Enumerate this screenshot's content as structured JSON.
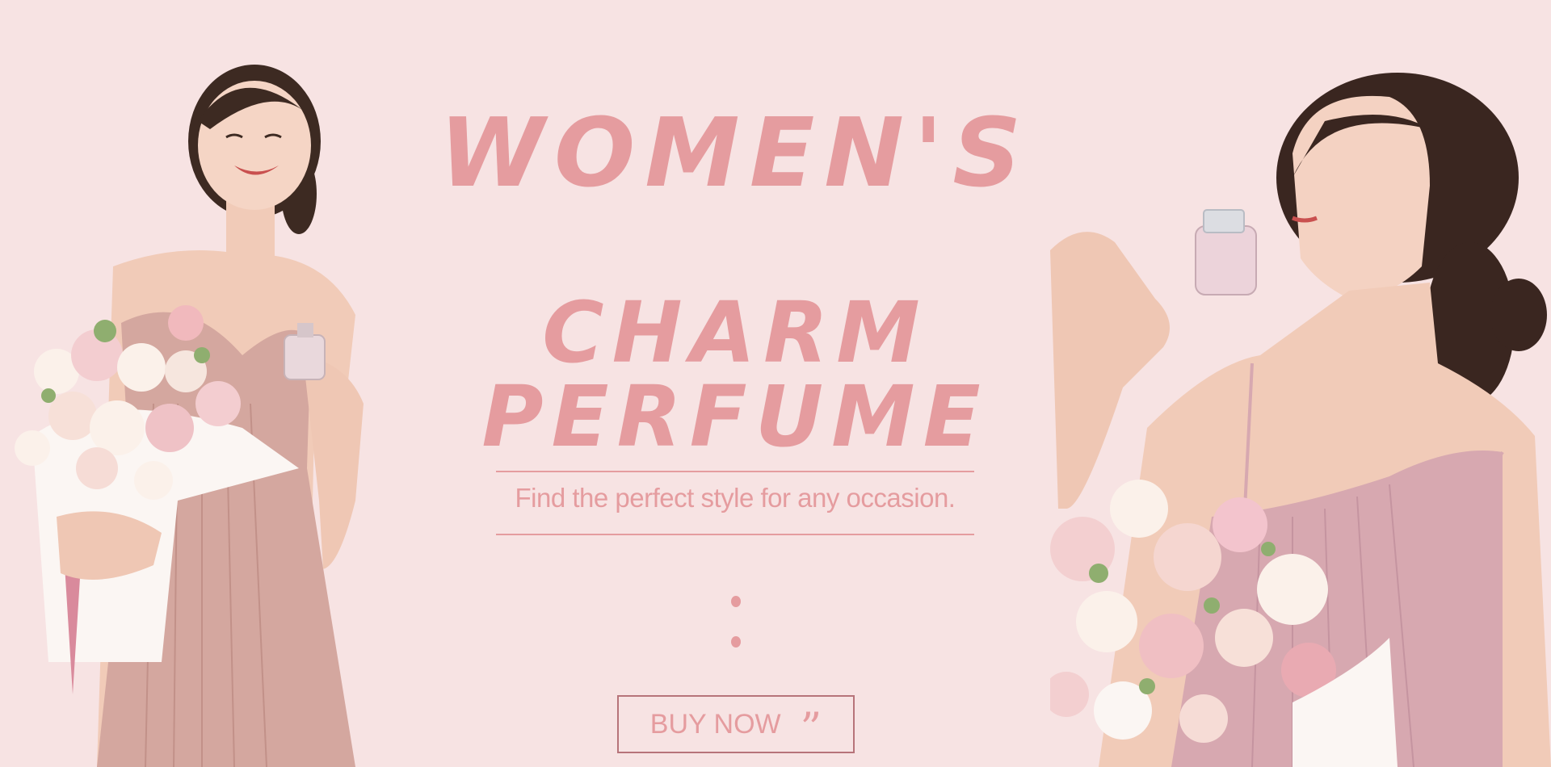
{
  "banner": {
    "headline_line1": "WOMEN'S",
    "headline_line2": "CHARM PERFUME",
    "tagline": "Find the perfect style for any occasion.",
    "cta_label": "BUY NOW",
    "cta_icon": "close-quote-icon"
  },
  "colors": {
    "background": "#f7e3e3",
    "accent": "#e59c9f",
    "button_border": "#b7747a"
  }
}
